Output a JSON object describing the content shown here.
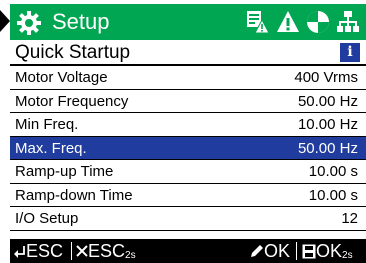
{
  "header": {
    "title": "Setup",
    "icons": [
      "gear-icon",
      "parameter-warning-icon",
      "alarm-icon",
      "status-circle-icon",
      "network-icon"
    ]
  },
  "subheader": {
    "title": "Quick Startup",
    "info_icon": "info-icon",
    "info_glyph": "i"
  },
  "menu": {
    "items": [
      {
        "label": "Motor Voltage",
        "value": "400 Vrms"
      },
      {
        "label": "Motor Frequency",
        "value": "50.00 Hz"
      },
      {
        "label": "Min Freq.",
        "value": "10.00 Hz"
      },
      {
        "label": "Max. Freq.",
        "value": "50.00 Hz"
      },
      {
        "label": "Ramp-up Time",
        "value": "10.00 s"
      },
      {
        "label": "Ramp-down Time",
        "value": "10.00 s"
      },
      {
        "label": "I/O Setup",
        "value": "12"
      }
    ],
    "selected_index": 3
  },
  "footer": {
    "back_label": "ESC",
    "cancel_label": "ESC",
    "cancel_sub": "2s",
    "ok_label": "OK",
    "save_label": "OK",
    "save_sub": "2s"
  },
  "colors": {
    "header_bg": "#00a651",
    "selected_bg": "#1f3c9e",
    "footer_bg": "#000000"
  }
}
